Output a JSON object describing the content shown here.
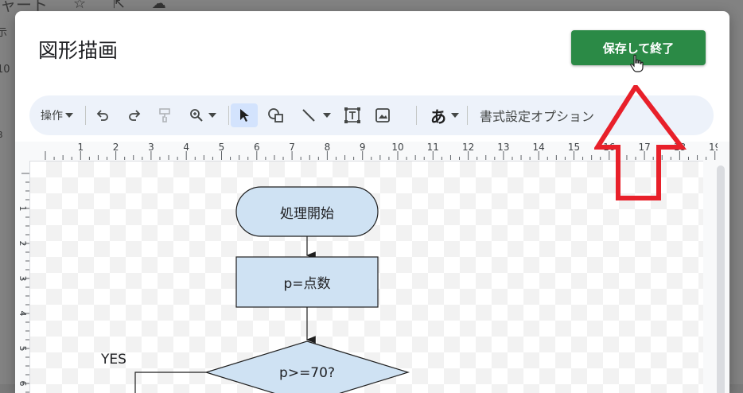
{
  "background": {
    "doc_title": "ャート",
    "side_labels": [
      "示",
      "10",
      "B"
    ]
  },
  "dialog": {
    "title": "図形描画",
    "save_button": "保存して終了"
  },
  "toolbar": {
    "actions_menu": "操作",
    "font_button": "あ",
    "format_options": "書式設定オプション",
    "icons": [
      "undo-icon",
      "redo-icon",
      "paint-format-icon",
      "zoom-icon",
      "select-icon",
      "shape-icon",
      "line-icon",
      "textbox-icon",
      "image-icon"
    ]
  },
  "ruler": {
    "h_marks": [
      "1",
      "2",
      "3",
      "4",
      "5",
      "6",
      "7",
      "8",
      "9",
      "10",
      "11",
      "12",
      "13",
      "14",
      "15",
      "16",
      "17",
      "18",
      "19"
    ],
    "v_marks": [
      "1",
      "2",
      "3",
      "4",
      "5",
      "6"
    ]
  },
  "flowchart": {
    "start_label": "処理開始",
    "process_label": "p=点数",
    "decision_label": "p>=70?",
    "branch_label": "YES"
  },
  "colors": {
    "accent_button": "#2b8a46",
    "shape_fill": "#cfe2f3",
    "annotation_arrow": "#e8202a"
  }
}
